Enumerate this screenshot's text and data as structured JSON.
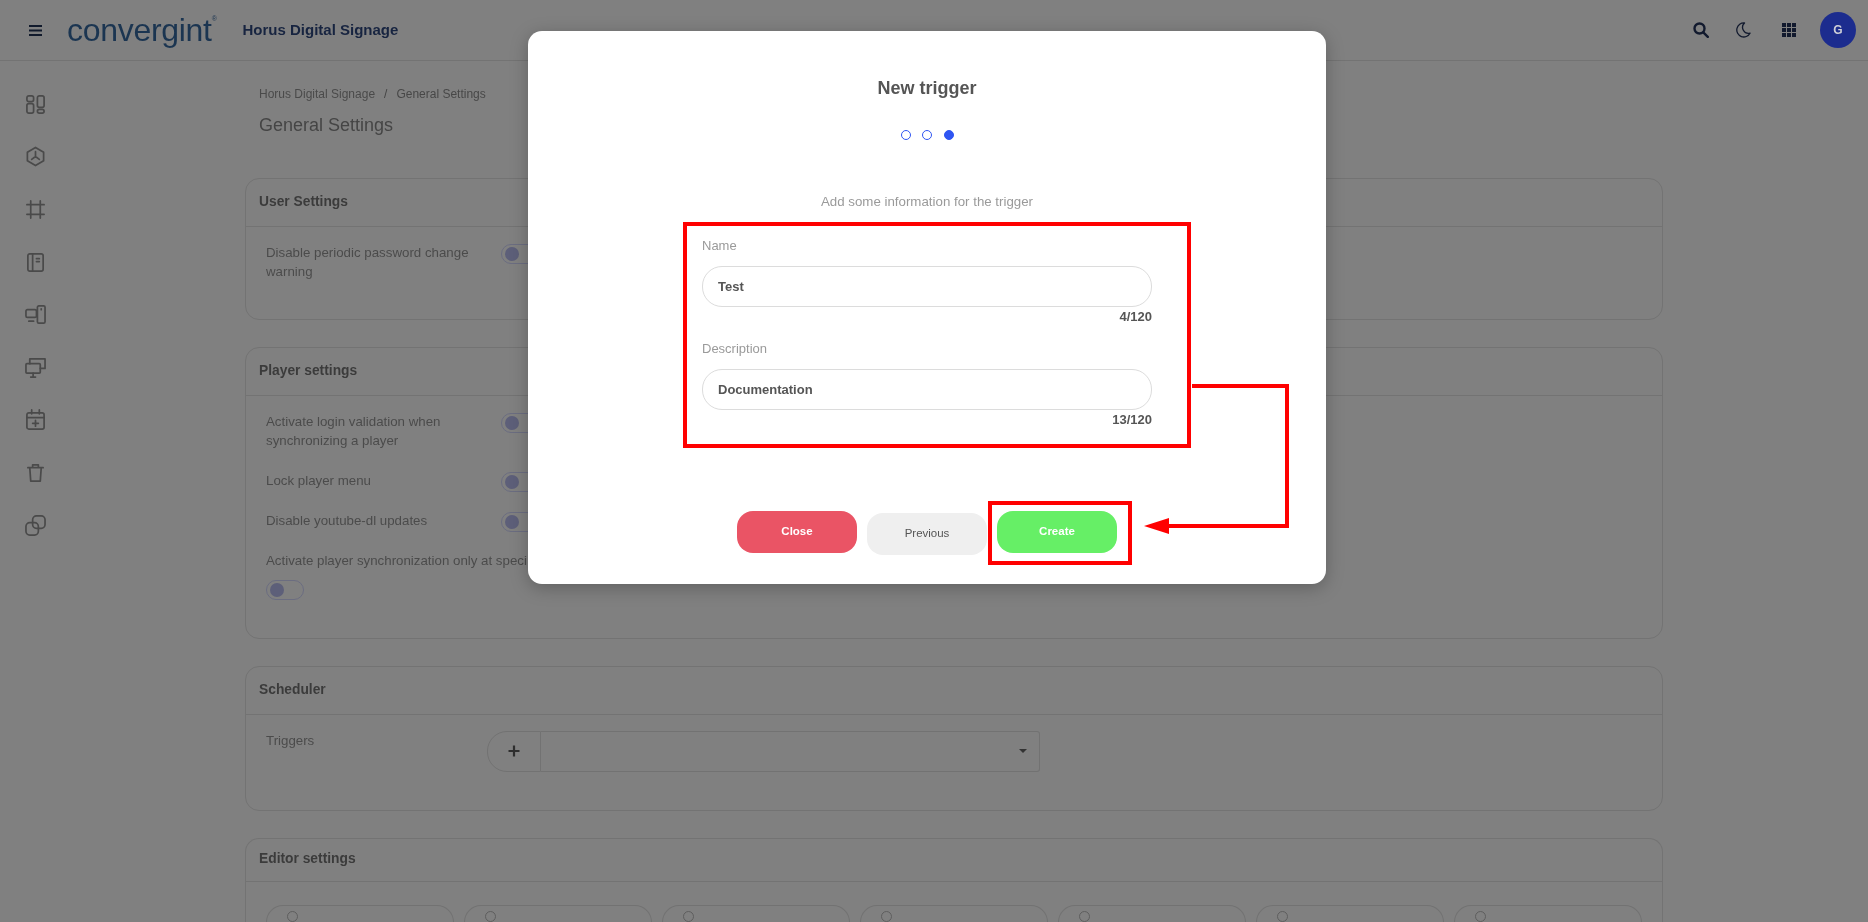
{
  "topbar": {
    "logo": "convergint$^{®}$",
    "app_title": "Horus Digital Signage",
    "avatar": "G"
  },
  "breadcrumb": {
    "items": [
      "Horus Digital Signage",
      "General Settings"
    ],
    "separator": "/"
  },
  "page_title": "General Settings",
  "sections": [
    {
      "title": "User Settings",
      "rows": [
        {
          "kind": "toggle",
          "label": "Disable periodic password change warning",
          "on": false
        }
      ]
    },
    {
      "title": "Player settings",
      "rows": [
        {
          "kind": "toggle",
          "label": "Activate login validation when synchronizing a player",
          "on": false
        },
        {
          "kind": "toggle",
          "label": "Lock player menu",
          "on": false
        },
        {
          "kind": "toggle",
          "label": "Disable youtube-dl updates",
          "on": false
        },
        {
          "kind": "toggle_below",
          "label": "Activate player synchronization only at speci",
          "on": false
        }
      ]
    },
    {
      "title": "Scheduler",
      "rows": [
        {
          "kind": "select",
          "label": "Triggers"
        }
      ]
    },
    {
      "title": "Editor settings",
      "rows": [
        {
          "kind": "option_pills"
        }
      ]
    }
  ],
  "modal": {
    "title": "New trigger",
    "steps": [
      {
        "selected": false
      },
      {
        "selected": false
      },
      {
        "selected": true
      }
    ],
    "subtitle": "Add some information for the trigger",
    "form_highlighted": true,
    "fields": [
      {
        "label": "Name",
        "value": "Test",
        "counter": "4/120"
      },
      {
        "label": "Description",
        "value": "Documentation",
        "counter": "13/120"
      }
    ],
    "buttons": [
      {
        "kind": "danger",
        "label": "Close",
        "highlighted": false
      },
      {
        "kind": "secondary",
        "label": "Previous",
        "highlighted": false
      },
      {
        "kind": "success",
        "label": "Create",
        "highlighted": true
      }
    ],
    "callout_arrow": true
  }
}
